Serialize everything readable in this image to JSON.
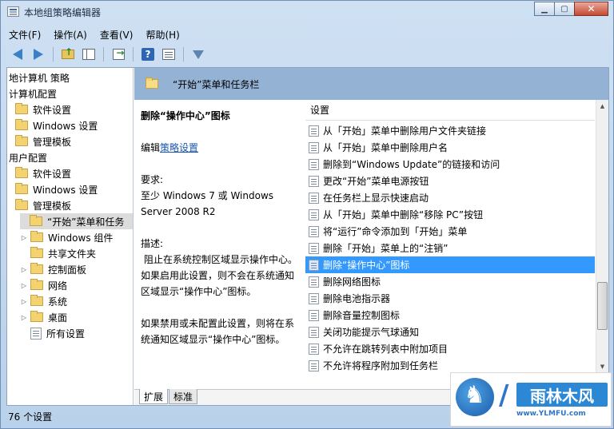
{
  "window": {
    "title": "本地组策略编辑器",
    "minimize_icon": "minimize-icon",
    "maximize_icon": "maximize-icon",
    "close_icon": "close-icon"
  },
  "menubar": {
    "items": [
      "文件(F)",
      "操作(A)",
      "查看(V)",
      "帮助(H)"
    ]
  },
  "toolbar": {
    "icons": [
      "back-arrow-icon",
      "forward-arrow-icon",
      "folder-up-icon",
      "show-hide-tree-icon",
      "export-list-icon",
      "help-icon",
      "properties-icon",
      "filter-icon"
    ]
  },
  "tree": {
    "items": [
      {
        "label": "地计算机 策略",
        "level": 0,
        "icon": "none"
      },
      {
        "label": "计算机配置",
        "level": 0,
        "icon": "none"
      },
      {
        "label": "软件设置",
        "level": 1,
        "icon": "folder-icon"
      },
      {
        "label": "Windows 设置",
        "level": 1,
        "icon": "folder-icon"
      },
      {
        "label": "管理模板",
        "level": 1,
        "icon": "folder-icon"
      },
      {
        "label": "用户配置",
        "level": 0,
        "icon": "none"
      },
      {
        "label": "软件设置",
        "level": 1,
        "icon": "folder-icon"
      },
      {
        "label": "Windows 设置",
        "level": 1,
        "icon": "folder-icon"
      },
      {
        "label": "管理模板",
        "level": 1,
        "icon": "folder-icon"
      },
      {
        "label": "“开始”菜单和任务",
        "level": 2,
        "icon": "folder-icon",
        "selected": true
      },
      {
        "label": "Windows 组件",
        "level": 2,
        "icon": "folder-icon",
        "expander": "▷"
      },
      {
        "label": "共享文件夹",
        "level": 2,
        "icon": "folder-icon"
      },
      {
        "label": "控制面板",
        "level": 2,
        "icon": "folder-icon",
        "expander": "▷"
      },
      {
        "label": "网络",
        "level": 2,
        "icon": "folder-icon",
        "expander": "▷"
      },
      {
        "label": "系统",
        "level": 2,
        "icon": "folder-icon",
        "expander": "▷"
      },
      {
        "label": "桌面",
        "level": 2,
        "icon": "folder-icon",
        "expander": "▷"
      },
      {
        "label": "所有设置",
        "level": 2,
        "icon": "settings-doc-icon"
      }
    ]
  },
  "pane_header": {
    "title": "“开始”菜单和任务栏"
  },
  "description": {
    "setting_title": "删除“操作中心”图标",
    "edit_prefix": "编辑",
    "edit_link": "策略设置",
    "requirements_label": "要求:",
    "requirements_text": "至少 Windows 7 或 Windows Server 2008 R2",
    "description_label": "描述:",
    "description_text1": "阻止在系统控制区域显示操作中心。如果启用此设置，则不会在系统通知区域显示“操作中心”图标。",
    "description_text2": "如果禁用或未配置此设置，则将在系统通知区域显示“操作中心”图标。"
  },
  "list": {
    "column_header": "设置",
    "rows": [
      "从「开始」菜单中删除用户文件夹链接",
      "从「开始」菜单中删除用户名",
      "删除到“Windows Update”的链接和访问",
      "更改“开始”菜单电源按钮",
      "在任务栏上显示快速启动",
      "从「开始」菜单中删除“移除 PC”按钮",
      "将“运行”命令添加到「开始」菜单",
      "删除「开始」菜单上的“注销”",
      "删除“操作中心”图标",
      "删除网络图标",
      "删除电池指示器",
      "删除音量控制图标",
      "关闭功能提示气球通知",
      "不允许在跳转列表中附加项目",
      "不允许将程序附加到任务栏"
    ],
    "selected_index": 8
  },
  "tabs": {
    "items": [
      "扩展",
      "标准"
    ],
    "active": 0
  },
  "statusbar": {
    "text": "76 个设置"
  },
  "watermark": {
    "slash": "/",
    "name": "雨林木风",
    "url": "www.YLMFU.com"
  }
}
